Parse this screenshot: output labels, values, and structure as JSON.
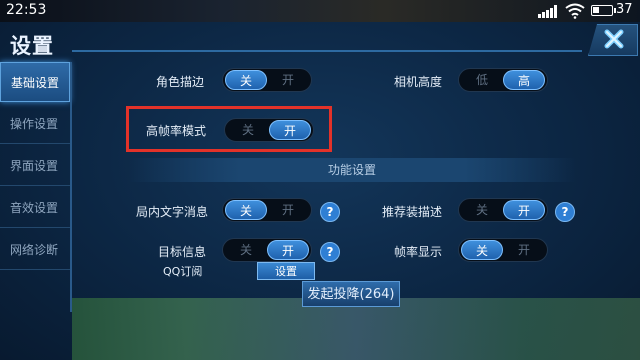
{
  "status_bar": {
    "time": "22:53",
    "battery": "37",
    "battery_level": 0.37
  },
  "header": {
    "title": "设置"
  },
  "sidebar": {
    "items": [
      {
        "label": "基础设置",
        "active": true
      },
      {
        "label": "操作设置",
        "active": false
      },
      {
        "label": "界面设置",
        "active": false
      },
      {
        "label": "音效设置",
        "active": false
      },
      {
        "label": "网络诊断",
        "active": false
      }
    ]
  },
  "settings": {
    "outline": {
      "label": "角色描边",
      "left": "关",
      "right": "开",
      "selected": "left"
    },
    "camera_height": {
      "label": "相机高度",
      "left": "低",
      "right": "高",
      "selected": "right"
    },
    "high_fps": {
      "label": "高帧率模式",
      "left": "关",
      "right": "开",
      "selected": "right"
    }
  },
  "function_section": {
    "title": "功能设置",
    "ingame_text": {
      "label": "局内文字消息",
      "left": "关",
      "right": "开",
      "selected": "left",
      "help": "?"
    },
    "recommend_desc": {
      "label": "推荐装描述",
      "left": "关",
      "right": "开",
      "selected": "right",
      "help": "?"
    },
    "target_info": {
      "label": "目标信息",
      "left": "关",
      "right": "开",
      "selected": "right",
      "help": "?"
    },
    "fps_display": {
      "label": "帧率显示",
      "left": "关",
      "right": "开",
      "selected": "left"
    },
    "qq_subscribe": {
      "label": "QQ订阅",
      "button": "设置"
    }
  },
  "footer": {
    "surrender_button": "发起投降(264)"
  },
  "colors": {
    "accent": "#3f8fdc",
    "highlight": "#e33229",
    "background": "#0c2643"
  }
}
